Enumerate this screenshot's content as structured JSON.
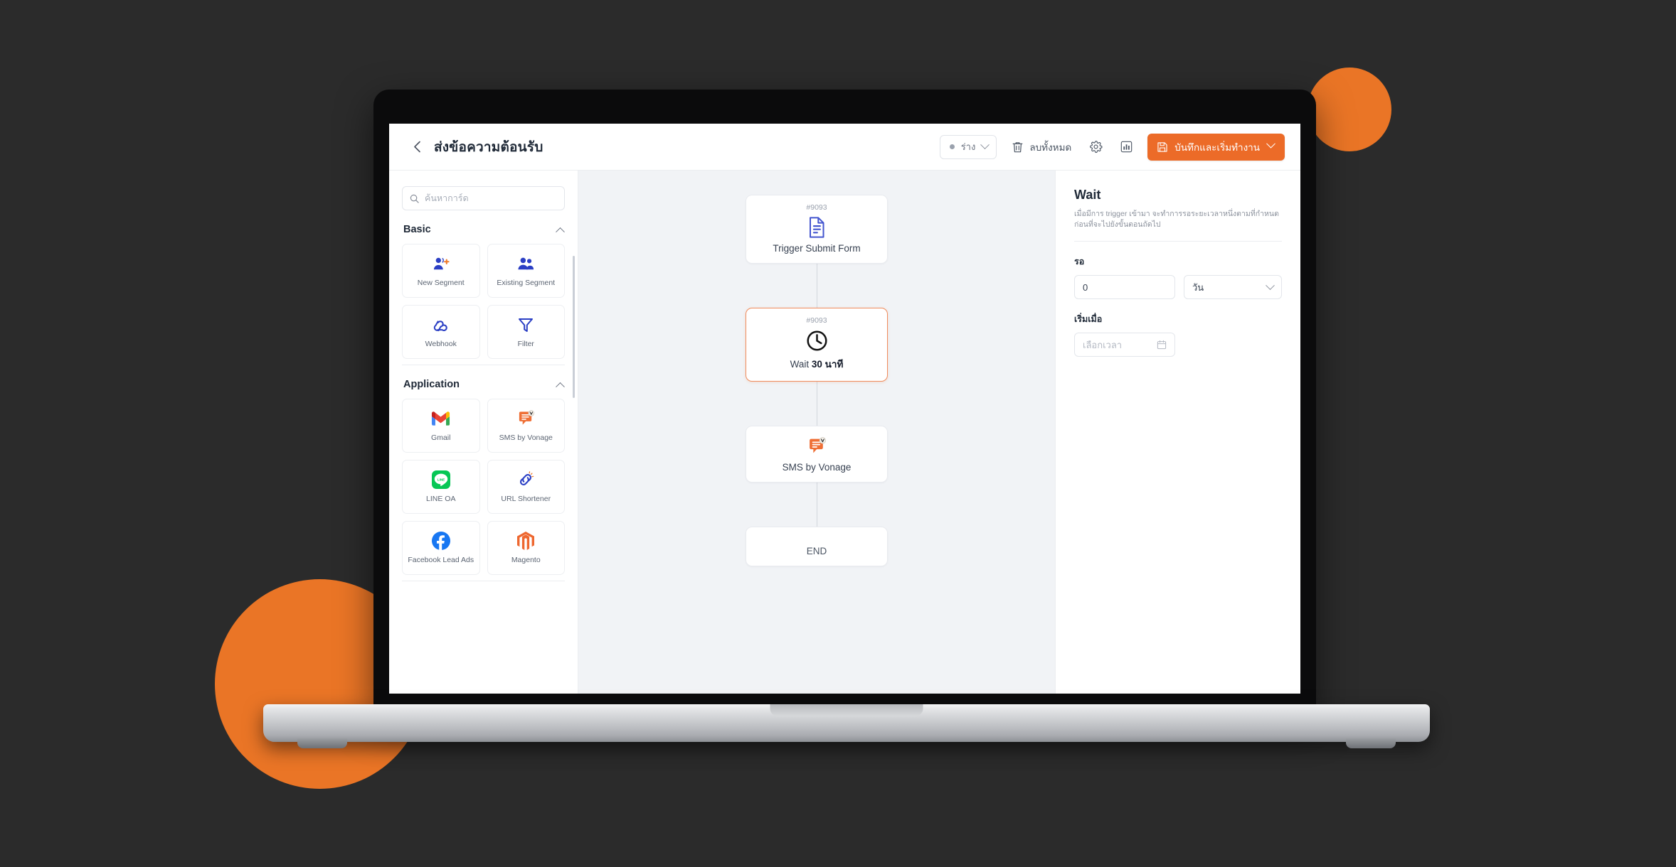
{
  "topbar": {
    "back_icon": "chevron-left-icon",
    "title": "ส่งข้อความต้อนรับ",
    "status": {
      "label": "ร่าง",
      "dot_color": "#9aa1ad"
    },
    "delete_all": {
      "label": "ลบทั้งหมด",
      "icon": "trash-icon"
    },
    "settings_icon": "gear-icon",
    "report_icon": "bar-chart-icon",
    "save": {
      "label": "บันทึกและเริ่มทำงาน",
      "icon": "save-disk-icon",
      "color": "#ec6b28"
    }
  },
  "sidebar": {
    "search": {
      "placeholder": "ค้นหาการ์ด",
      "value": "",
      "icon": "search-icon"
    },
    "sections": [
      {
        "title": "Basic",
        "collapse_icon": "chevron-up-icon",
        "cards": [
          {
            "label": "New Segment",
            "icon": "new-segment-icon"
          },
          {
            "label": "Existing Segment",
            "icon": "existing-segment-icon"
          },
          {
            "label": "Webhook",
            "icon": "webhook-icon"
          },
          {
            "label": "Filter",
            "icon": "filter-icon"
          }
        ]
      },
      {
        "title": "Application",
        "collapse_icon": "chevron-up-icon",
        "cards": [
          {
            "label": "Gmail",
            "icon": "gmail-icon"
          },
          {
            "label": "SMS by Vonage",
            "icon": "sms-vonage-icon"
          },
          {
            "label": "LINE OA",
            "icon": "line-oa-icon"
          },
          {
            "label": "URL Shortener",
            "icon": "url-shortener-icon"
          },
          {
            "label": "Facebook Lead Ads",
            "icon": "facebook-icon"
          },
          {
            "label": "Magento",
            "icon": "magento-icon"
          }
        ]
      }
    ]
  },
  "canvas": {
    "nodes": [
      {
        "id": "#9093",
        "title": "Trigger Submit Form",
        "title_bold": "",
        "icon": "document-trigger-icon",
        "selected": false
      },
      {
        "id": "#9093",
        "title": "Wait ",
        "title_bold": "30 นาที",
        "icon": "clock-icon",
        "selected": true
      },
      {
        "id": "",
        "title": "SMS by Vonage",
        "title_bold": "",
        "icon": "sms-vonage-icon",
        "selected": false
      }
    ],
    "end_label": "END"
  },
  "panel": {
    "title": "Wait",
    "description": "เมื่อมีการ trigger เข้ามา จะทำการรอระยะเวลาหนึ่งตามที่กำหนด ก่อนที่จะไปยังขั้นตอนถัดไป",
    "wait_label": "รอ",
    "wait_value": "0",
    "wait_unit": "วัน",
    "start_label": "เริ่มเมื่อ",
    "start_placeholder": "เลือกเวลา",
    "calendar_icon": "calendar-icon"
  }
}
